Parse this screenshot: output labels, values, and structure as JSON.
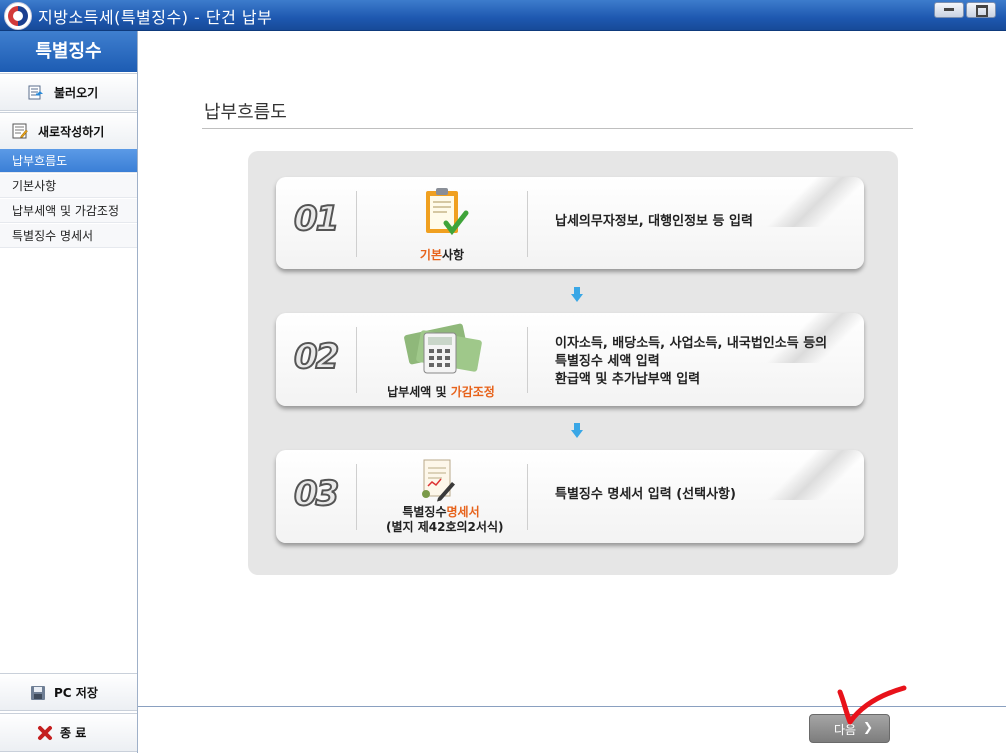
{
  "window": {
    "title": "지방소득세(특별징수) - 단건 납부"
  },
  "sidebar": {
    "header": "특별징수",
    "load_button": "불러오기",
    "new_button": "새로작성하기",
    "items": [
      {
        "label": "납부흐름도",
        "active": true
      },
      {
        "label": "기본사항",
        "active": false
      },
      {
        "label": "납부세액 및 가감조정",
        "active": false
      },
      {
        "label": "특별징수 명세서",
        "active": false
      }
    ],
    "save_button": "PC 저장",
    "exit_button": "종 료"
  },
  "main": {
    "title": "납부흐름도",
    "steps": [
      {
        "number": "01",
        "label_plain": "사항",
        "label_highlight": "기본",
        "description": [
          "납세의무자정보, 대행인정보 등 입력"
        ],
        "icon": "clipboard-check-icon"
      },
      {
        "number": "02",
        "label_plain": "납부세액 및 ",
        "label_highlight": "가감조정",
        "description": [
          "이자소득, 배당소득, 사업소득, 내국법인소득 등의",
          "특별징수 세액 입력",
          "환급액 및 추가납부액 입력"
        ],
        "icon": "calculator-money-icon"
      },
      {
        "number": "03",
        "label_plain": "특별징수",
        "label_highlight": "명세서",
        "label_sub": "(별지 제42호의2서식)",
        "description": [
          "특별징수 명세서 입력 (선택사항)"
        ],
        "icon": "document-pen-icon"
      }
    ],
    "next_button": "다음"
  },
  "colors": {
    "titlebar": "#1e58b0",
    "sidebar_active": "#3b7fd6",
    "highlight_text": "#e7621a",
    "flow_arrow": "#3aa7e6",
    "annotation_check": "#e8121a"
  }
}
